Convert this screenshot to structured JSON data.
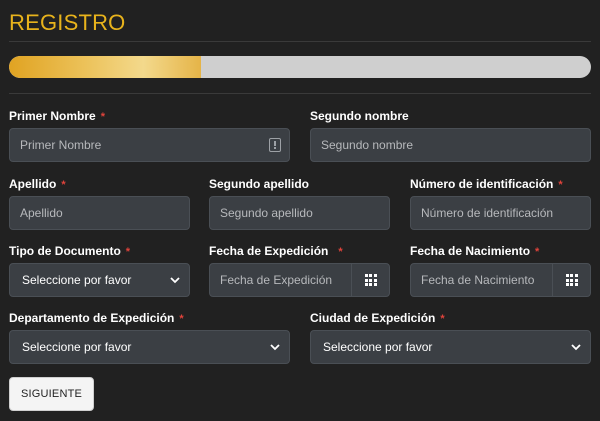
{
  "title": "REGISTRO",
  "progress": {
    "percent": 33,
    "color": "#e8b31c"
  },
  "required_marker": "*",
  "fields": {
    "primer_nombre": {
      "label": "Primer Nombre",
      "placeholder": "Primer Nombre",
      "required": true
    },
    "segundo_nombre": {
      "label": "Segundo nombre",
      "placeholder": "Segundo nombre",
      "required": false
    },
    "apellido": {
      "label": "Apellido",
      "placeholder": "Apellido",
      "required": true
    },
    "segundo_apellido": {
      "label": "Segundo apellido",
      "placeholder": "Segundo apellido",
      "required": false
    },
    "numero_identificacion": {
      "label": "Número de identificación",
      "placeholder": "Número de identificación",
      "required": true
    },
    "tipo_documento": {
      "label": "Tipo de Documento",
      "value": "Seleccione por favor",
      "required": true
    },
    "fecha_expedicion": {
      "label": "Fecha de Expedición",
      "placeholder": "Fecha de Expedición",
      "required": true
    },
    "fecha_nacimiento": {
      "label": "Fecha de Nacimiento",
      "placeholder": "Fecha de Nacimiento",
      "required": true
    },
    "departamento_expedicion": {
      "label": "Departamento de Expedición",
      "value": "Seleccione por favor",
      "required": true
    },
    "ciudad_expedicion": {
      "label": "Ciudad de Expedición",
      "value": "Seleccione por favor",
      "required": true
    }
  },
  "buttons": {
    "next": "SIGUIENTE"
  },
  "icons": {
    "calendar": "calendar-grid-icon",
    "dropdown": "chevron-down-icon",
    "autofill": "keyboard-alert-icon"
  }
}
